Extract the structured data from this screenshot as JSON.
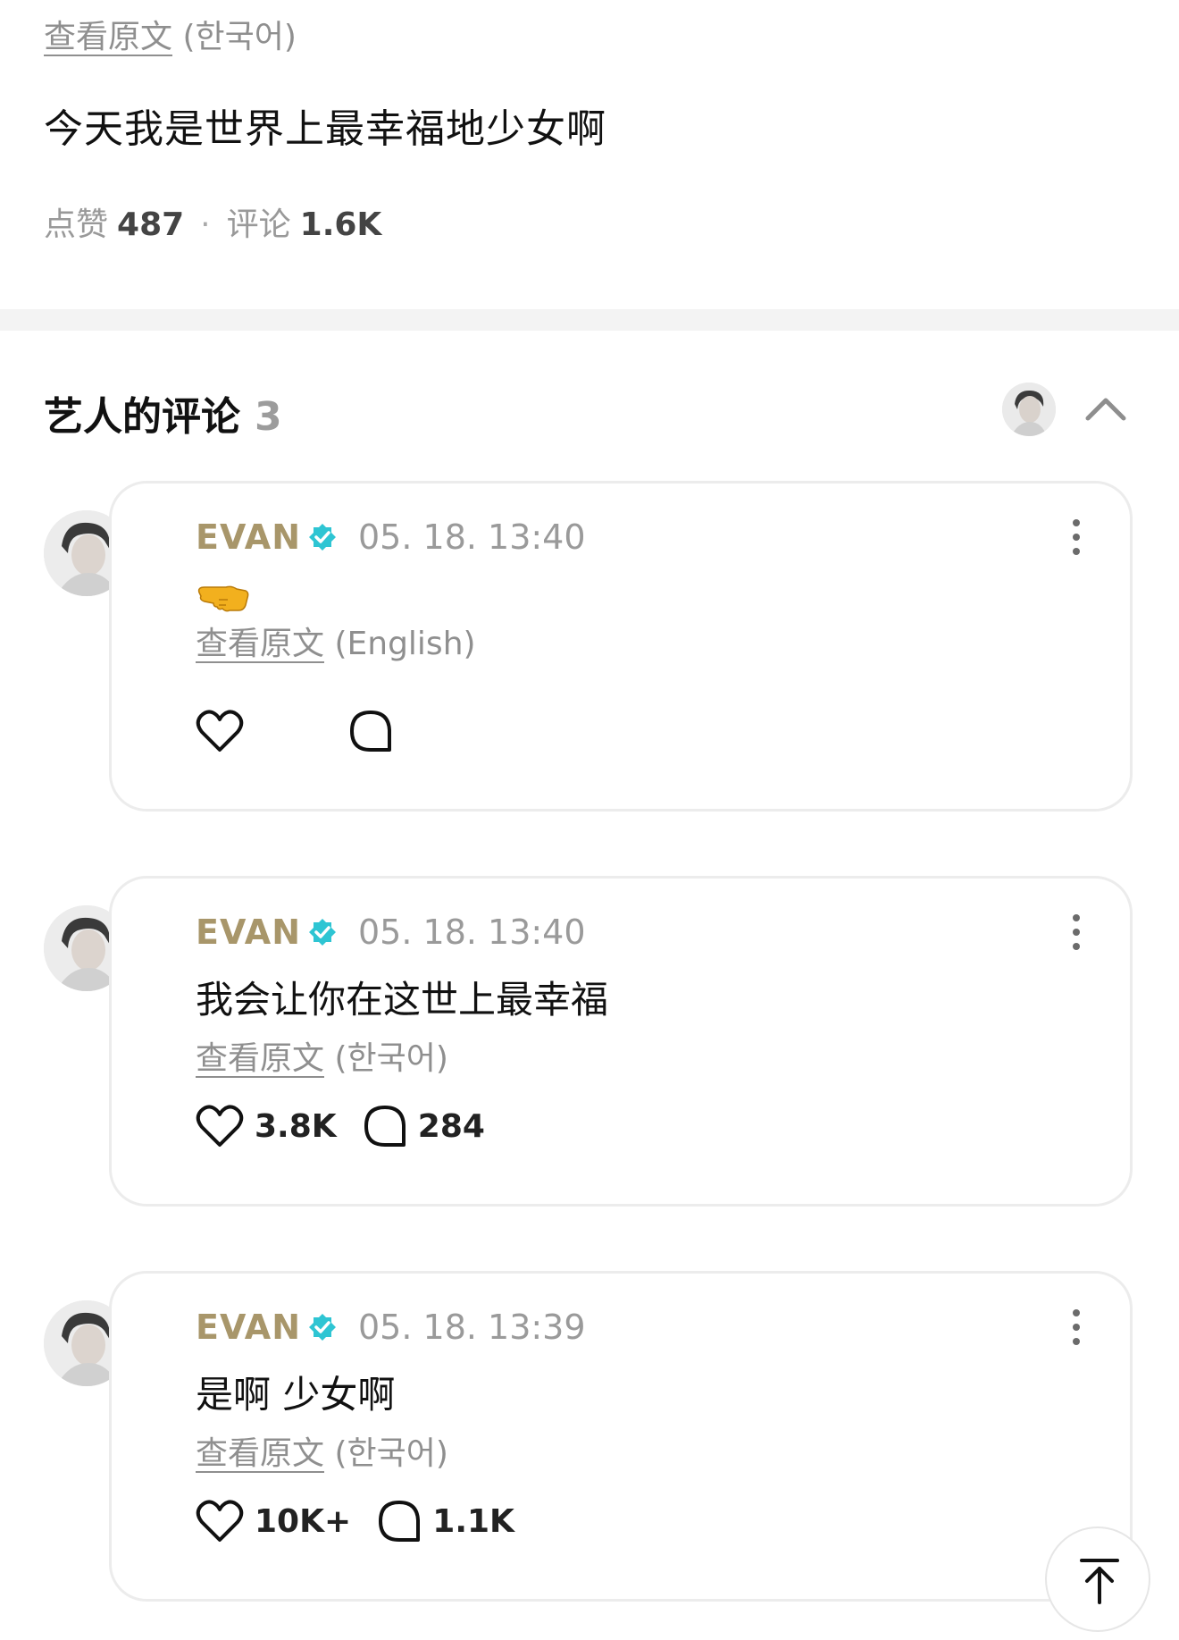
{
  "post": {
    "translate_link": "查看原文",
    "translate_lang": "(한국어)",
    "text": "今天我是世界上最幸福地少女啊",
    "likes_label": "点赞",
    "likes_count": "487",
    "separator": "·",
    "comments_label": "评论",
    "comments_count": "1.6K"
  },
  "section": {
    "title": "艺人的评论",
    "count": "3",
    "collapse_icon": "chevron-up-icon"
  },
  "comments": [
    {
      "author": "EVAN",
      "verified": true,
      "time": "05. 18. 13:40",
      "text": "",
      "emoji": "backhand-index-pointing-left",
      "translate_link": "查看原文",
      "translate_lang": "(English)",
      "likes": "",
      "replies": ""
    },
    {
      "author": "EVAN",
      "verified": true,
      "time": "05. 18. 13:40",
      "text": "我会让你在这世上最幸福",
      "translate_link": "查看原文",
      "translate_lang": "(한국어)",
      "likes": "3.8K",
      "replies": "284"
    },
    {
      "author": "EVAN",
      "verified": true,
      "time": "05. 18. 13:39",
      "text": "是啊 少女啊",
      "translate_link": "查看原文",
      "translate_lang": "(한국어)",
      "likes": "10K+",
      "replies": "1.1K"
    }
  ],
  "colors": {
    "author": "#a8966a",
    "verified_badge": "#2ec5d3",
    "muted_text": "#8f8f8f",
    "card_border": "#ececec",
    "divider": "#f3f3f3"
  },
  "icons": {
    "like": "heart-icon",
    "reply": "speech-bubble-icon",
    "more": "more-vertical-icon",
    "scroll_top": "arrow-up-to-top-icon"
  }
}
